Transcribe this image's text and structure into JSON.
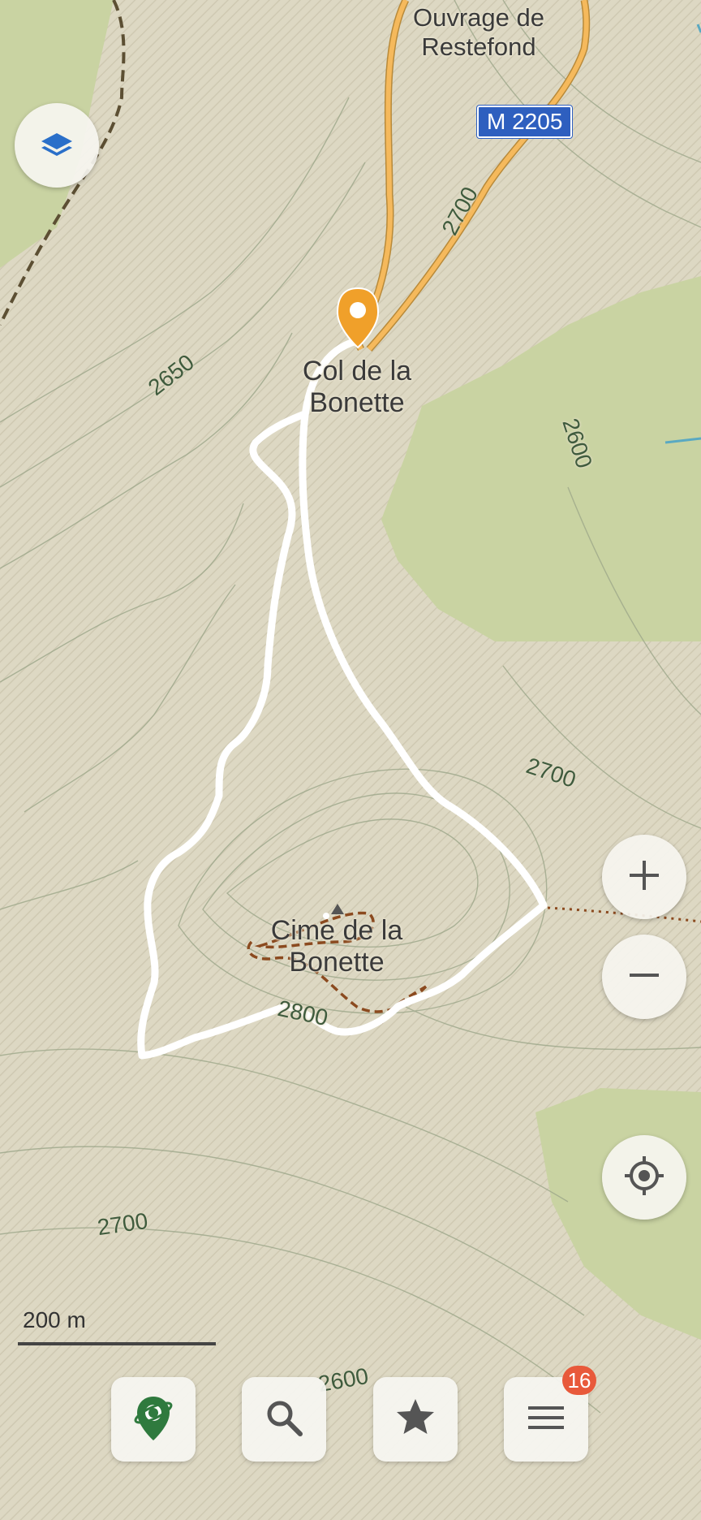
{
  "map": {
    "places": [
      {
        "id": "ouvrage",
        "name": "Ouvrage de\nRestefond"
      },
      {
        "id": "col",
        "name": "Col de la\nBonette"
      },
      {
        "id": "cime",
        "name": "Cime de la\nBonette"
      }
    ],
    "road_ref": "M 2205",
    "contours": [
      "2700",
      "2650",
      "2600",
      "2700",
      "2800",
      "2700",
      "2600"
    ],
    "scale": "200 m",
    "colors": {
      "background": "#ddd8c3",
      "forest": "#c9d3a2",
      "road": "#f5b95c",
      "track": "#ffffff",
      "trail": "#8b4a1f",
      "water": "#5aa9c2",
      "pin": "#f0a02a",
      "badge": "#e8593a"
    }
  },
  "controls": {
    "layers_icon": "layers-icon",
    "zoom_in_icon": "plus-icon",
    "zoom_out_icon": "minus-icon",
    "locate_icon": "crosshair-icon"
  },
  "toolbar": {
    "items": [
      {
        "icon": "planet-pin-icon"
      },
      {
        "icon": "search-icon"
      },
      {
        "icon": "star-icon"
      },
      {
        "icon": "menu-icon",
        "badge": "16"
      }
    ]
  }
}
